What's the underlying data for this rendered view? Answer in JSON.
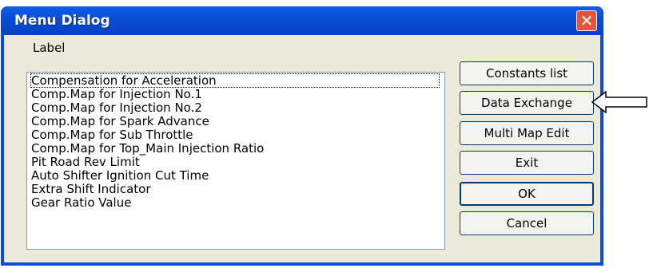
{
  "window": {
    "title": "Menu Dialog",
    "close_symbol": "✕"
  },
  "label_title": "Label",
  "list": {
    "items": [
      "Compensation for Acceleration",
      "Comp.Map for Injection No.1",
      "Comp.Map for Injection No.2",
      "Comp.Map for Spark Advance",
      "Comp.Map for Sub Throttle",
      "Comp.Map for Top_Main Injection Ratio",
      "Pit Road Rev Limit",
      "Auto Shifter Ignition Cut Time",
      "Extra Shift Indicator",
      "Gear Ratio Value"
    ],
    "selected_index": 0
  },
  "buttons": {
    "constants": "Constants list",
    "data_exchange": "Data Exchange",
    "multi_map": "Multi Map Edit",
    "exit": "Exit",
    "ok": "OK",
    "cancel": "Cancel"
  },
  "colors": {
    "titlebar": "#0a4ed4",
    "close": "#e4553b",
    "client": "#ece9d8"
  },
  "icons": {
    "close": "close-icon",
    "pointer": "left-arrow-icon"
  }
}
